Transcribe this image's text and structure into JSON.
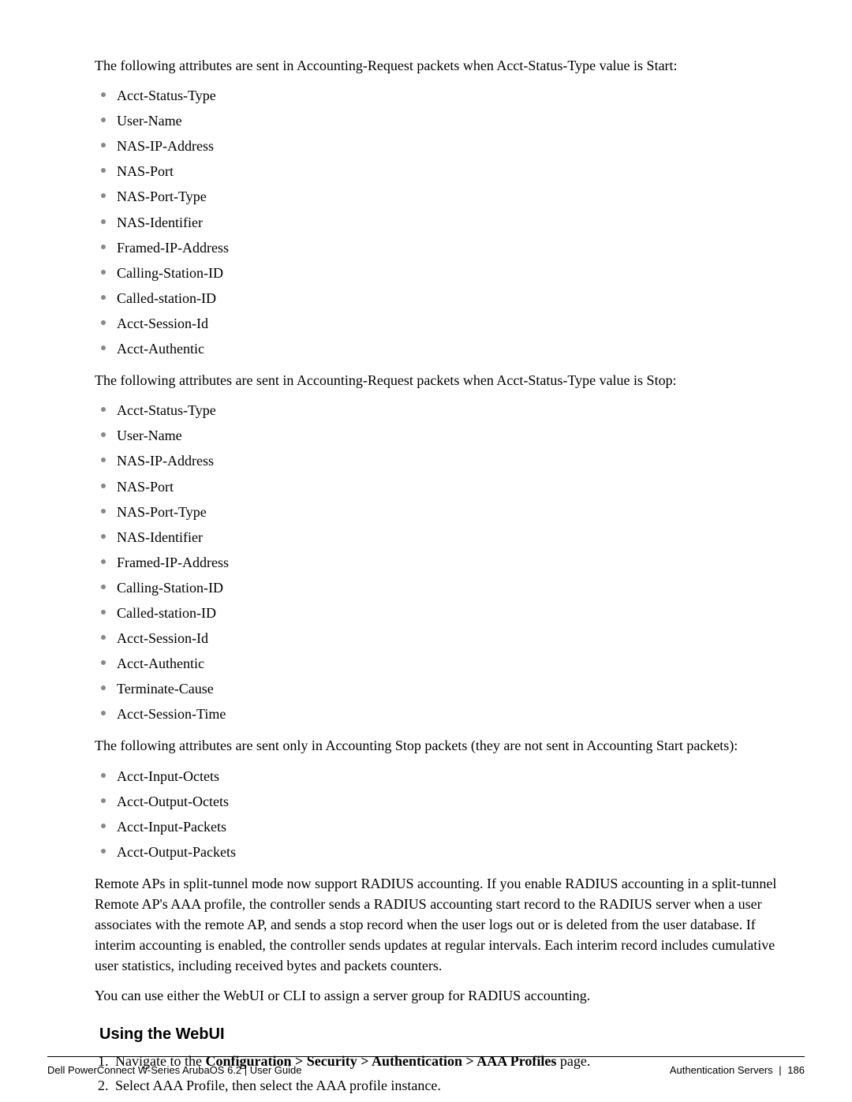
{
  "intro_start": "The following attributes are sent in Accounting-Request packets when Acct-Status-Type value is Start:",
  "list_start": [
    "Acct-Status-Type",
    "User-Name",
    "NAS-IP-Address",
    "NAS-Port",
    "NAS-Port-Type",
    "NAS-Identifier",
    "Framed-IP-Address",
    "Calling-Station-ID",
    "Called-station-ID",
    "Acct-Session-Id",
    "Acct-Authentic"
  ],
  "intro_stop": "The following attributes are sent in Accounting-Request packets when Acct-Status-Type value is Stop:",
  "list_stop": [
    "Acct-Status-Type",
    "User-Name",
    "NAS-IP-Address",
    "NAS-Port",
    "NAS-Port-Type",
    "NAS-Identifier",
    "Framed-IP-Address",
    "Calling-Station-ID",
    "Called-station-ID",
    "Acct-Session-Id",
    "Acct-Authentic",
    "Terminate-Cause",
    "Acct-Session-Time"
  ],
  "intro_only_stop": "The following attributes are sent only in Accounting Stop packets (they are not sent in Accounting Start packets):",
  "list_only_stop": [
    "Acct-Input-Octets",
    "Acct-Output-Octets",
    "Acct-Input-Packets",
    "Acct-Output-Packets"
  ],
  "para_remote_aps": "Remote APs in split-tunnel mode now support RADIUS accounting. If you enable RADIUS accounting in a split-tunnel Remote AP's AAA profile, the controller sends a RADIUS accounting start record to the RADIUS server when a user associates with the remote AP, and sends a stop record when the user logs out or is deleted from the user database. If interim accounting is enabled, the controller sends updates at regular intervals. Each interim record includes cumulative user statistics, including received bytes and packets counters.",
  "para_you_can_use": "You can use either the WebUI or CLI to assign a server group for RADIUS accounting.",
  "heading_webui": "Using the WebUI",
  "step1_prefix": "Navigate to the ",
  "step1_bold": "Configuration > Security > Authentication > AAA Profiles",
  "step1_suffix": " page.",
  "step2": "Select AAA Profile, then select the AAA profile instance.",
  "footer": {
    "left": "Dell PowerConnect W-Series ArubaOS 6.2  |  User Guide",
    "right_section": "Authentication Servers",
    "right_page": "186"
  }
}
